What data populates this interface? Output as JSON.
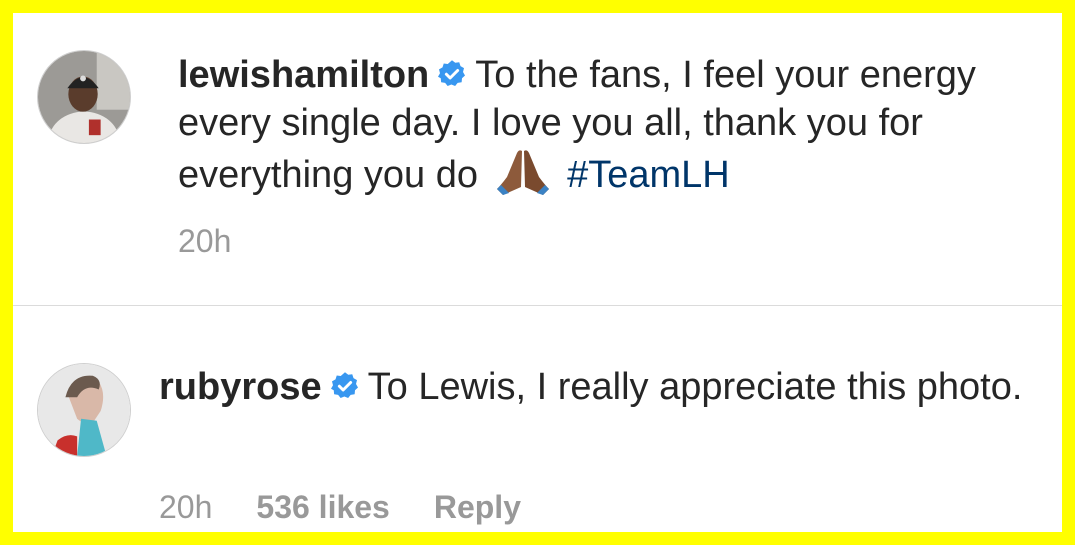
{
  "comments": [
    {
      "username": "lewishamilton",
      "verified": true,
      "text": "To the fans, I feel your energy every single day. I love you all, thank you for everything you do",
      "emoji": "folded-hands",
      "hashtag": "#TeamLH",
      "time": "20h"
    },
    {
      "username": "rubyrose",
      "verified": true,
      "text": "To Lewis, I really appreciate this photo.",
      "time": "20h",
      "likes": "536 likes",
      "reply": "Reply"
    }
  ],
  "colors": {
    "frame": "#ffff00",
    "verified": "#3897f0",
    "hashtag": "#003569",
    "meta": "#999999"
  }
}
